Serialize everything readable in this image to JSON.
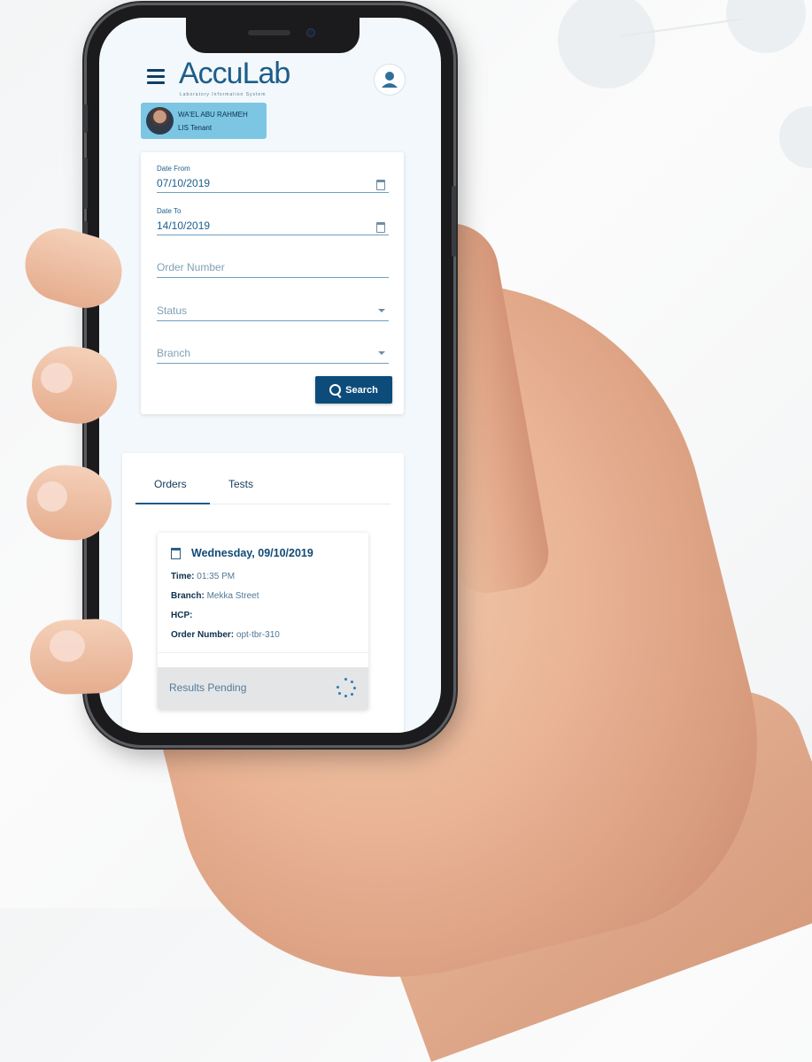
{
  "app": {
    "logo_text": "AccuLab",
    "logo_subtitle": "Laboratory Information System"
  },
  "user": {
    "name": "WA'EL ABU RAHMEH",
    "role": "LIS Tenant"
  },
  "filters": {
    "date_from_label": "Date From",
    "date_from_value": "07/10/2019",
    "date_to_label": "Date To",
    "date_to_value": "14/10/2019",
    "order_number_placeholder": "Order Number",
    "status_placeholder": "Status",
    "branch_placeholder": "Branch",
    "search_label": "Search"
  },
  "tabs": [
    {
      "label": "Orders",
      "active": true
    },
    {
      "label": "Tests",
      "active": false
    }
  ],
  "order": {
    "date": "Wednesday, 09/10/2019",
    "time_label": "Time:",
    "time_value": "01:35 PM",
    "branch_label": "Branch:",
    "branch_value": "Mekka Street",
    "hcp_label": "HCP:",
    "hcp_value": "",
    "order_number_label": "Order Number:",
    "order_number_value": "opt-tbr-310",
    "status": "Results Pending"
  },
  "colors": {
    "primary": "#0d4c7a",
    "accent": "#7cc6e4",
    "text_blue": "#1b5f8f"
  }
}
